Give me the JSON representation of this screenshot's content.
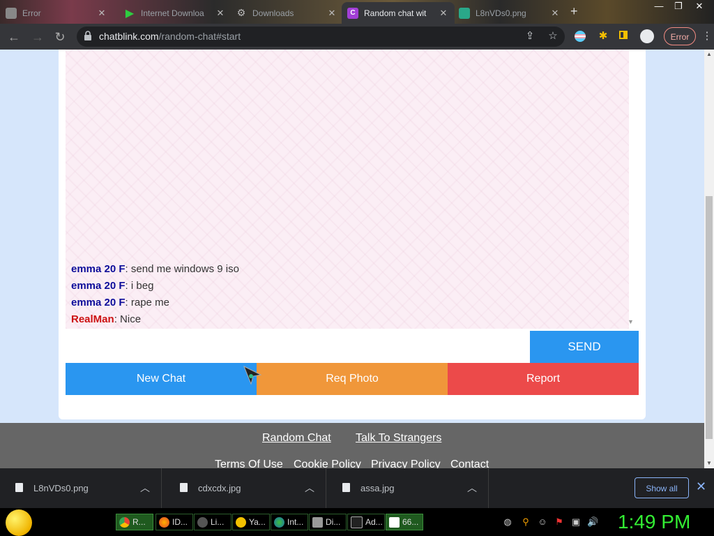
{
  "browser": {
    "tabs": [
      {
        "title": "Error",
        "favicon": "document-icon"
      },
      {
        "title": "Internet Downloa",
        "favicon": "download-arrow-icon"
      },
      {
        "title": "Downloads",
        "favicon": "gear-icon"
      },
      {
        "title": "Random chat wit",
        "favicon": "chatblink-icon",
        "active": true
      },
      {
        "title": "L8nVDs0.png",
        "favicon": "image-icon"
      }
    ],
    "new_tab": "+",
    "url_domain": "chatblink.com",
    "url_path": "/random-chat#start",
    "error_label": "Error"
  },
  "chat": {
    "messages": [
      {
        "sender": "emma 20 F",
        "text": ": send me windows 9 iso",
        "self": false
      },
      {
        "sender": "emma 20 F",
        "text": ": i beg",
        "self": false
      },
      {
        "sender": "emma 20 F",
        "text": ": rape me",
        "self": false
      },
      {
        "sender": "RealMan",
        "text": ": Nice",
        "self": true
      }
    ],
    "input_value": "",
    "send_label": "SEND",
    "new_chat_label": "New Chat",
    "req_photo_label": "Req Photo",
    "report_label": "Report",
    "colors": {
      "send": "#2a96f0",
      "new_chat": "#2a96f0",
      "req_photo": "#f0973a",
      "report": "#ec4a4a"
    }
  },
  "footer": {
    "links_row1": [
      "Random Chat",
      "Talk To Strangers"
    ],
    "links_row2": [
      "Terms Of Use",
      "Cookie Policy",
      "Privacy Policy",
      "Contact"
    ]
  },
  "downloads": {
    "files": [
      "L8nVDs0.png",
      "cdxcdx.jpg",
      "assa.jpg"
    ],
    "show_all": "Show all"
  },
  "taskbar": {
    "items": [
      "R...",
      "ID...",
      "Li...",
      "Ya...",
      "Int...",
      "Di...",
      "Ad...",
      "66..."
    ],
    "clock": "1:49 PM"
  }
}
